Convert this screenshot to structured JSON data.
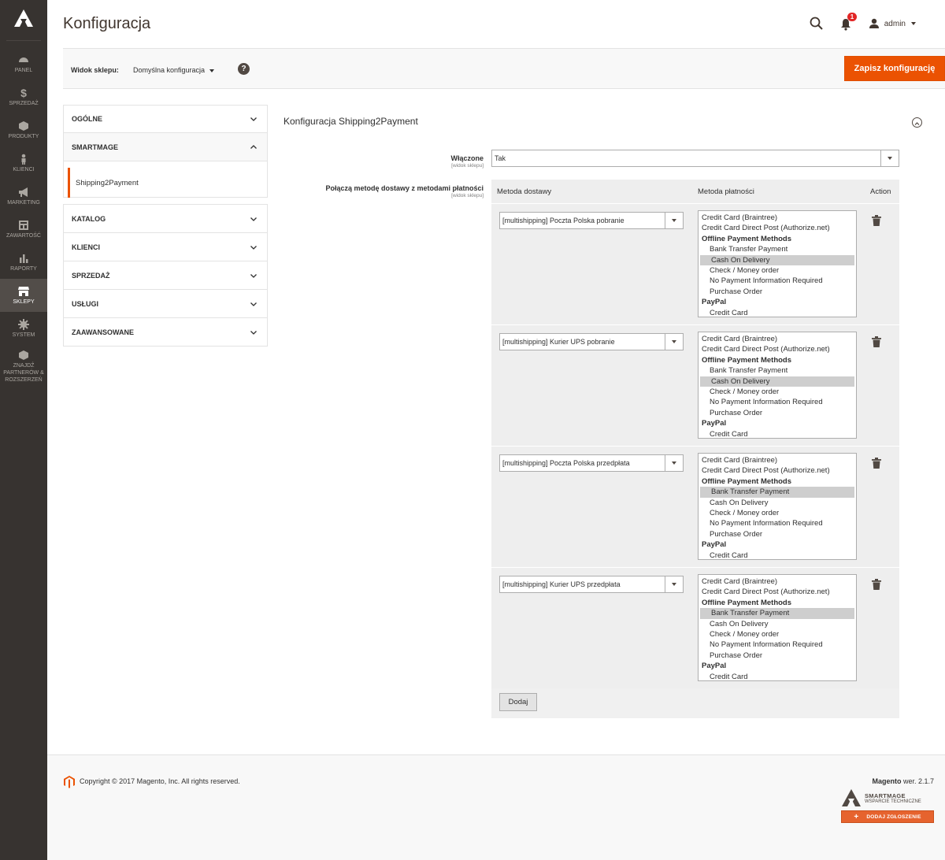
{
  "sidebar": {
    "items": [
      {
        "label": "PANEL",
        "icon": "dashboard-icon"
      },
      {
        "label": "SPRZEDAŻ",
        "icon": "dollar-icon"
      },
      {
        "label": "PRODUKTY",
        "icon": "box-icon"
      },
      {
        "label": "KLIENCI",
        "icon": "person-icon"
      },
      {
        "label": "MARKETING",
        "icon": "megaphone-icon"
      },
      {
        "label": "ZAWARTOŚĆ",
        "icon": "layout-icon"
      },
      {
        "label": "RAPORTY",
        "icon": "bar-chart-icon"
      },
      {
        "label": "SKLEPY",
        "icon": "store-icon",
        "active": true
      },
      {
        "label": "SYSTEM",
        "icon": "gear-icon"
      },
      {
        "label": "ZNAJDŹ PARTNERÓW & ROZSZERZEŃ",
        "icon": "extensions-icon"
      }
    ]
  },
  "header": {
    "title": "Konfiguracja",
    "notifications_count": "1",
    "user": "admin"
  },
  "store_bar": {
    "label": "Widok sklepu:",
    "scope": "Domyślna konfiguracja",
    "help": "?",
    "save_label": "Zapisz konfigurację"
  },
  "nav": {
    "sections": [
      {
        "label": "OGÓLNE"
      },
      {
        "label": "SMARTMAGE",
        "open": true,
        "sub": "Shipping2Payment"
      },
      {
        "label": "KATALOG"
      },
      {
        "label": "KLIENCI"
      },
      {
        "label": "SPRZEDAŻ"
      },
      {
        "label": "USŁUGI"
      },
      {
        "label": "ZAAWANSOWANE"
      }
    ]
  },
  "config": {
    "section_title": "Konfiguracja Shipping2Payment",
    "enabled_label": "Włączone",
    "enabled_scope": "[widok sklepu]",
    "enabled_value": "Tak",
    "mapping_label": "Połączą metodę dostawy z metodami płatności",
    "mapping_scope": "[widok sklepu]",
    "col_shipping": "Metoda dostawy",
    "col_payment": "Metoda płatności",
    "col_action": "Action",
    "add_label": "Dodaj",
    "payment_options": [
      {
        "label": "Credit Card (Braintree)",
        "type": "option"
      },
      {
        "label": "Credit Card Direct Post (Authorize.net)",
        "type": "option"
      },
      {
        "label": "Offline Payment Methods",
        "type": "group"
      },
      {
        "label": "Bank Transfer Payment",
        "type": "sub"
      },
      {
        "label": "Cash On Delivery",
        "type": "sub"
      },
      {
        "label": "Check / Money order",
        "type": "sub"
      },
      {
        "label": "No Payment Information Required",
        "type": "sub"
      },
      {
        "label": "Purchase Order",
        "type": "sub"
      },
      {
        "label": "PayPal",
        "type": "group"
      },
      {
        "label": "Credit Card",
        "type": "sub"
      }
    ],
    "rows": [
      {
        "shipping": "[multishipping] Poczta Polska pobranie",
        "selected_payment": "Cash On Delivery"
      },
      {
        "shipping": "[multishipping] Kurier UPS pobranie",
        "selected_payment": "Cash On Delivery"
      },
      {
        "shipping": "[multishipping] Poczta Polska przedpłata",
        "selected_payment": "Bank Transfer Payment"
      },
      {
        "shipping": "[multishipping] Kurier UPS przedpłata",
        "selected_payment": "Bank Transfer Payment"
      }
    ]
  },
  "footer": {
    "copyright": "Copyright © 2017 Magento, Inc. All rights reserved.",
    "brand": "Magento",
    "version": " wer. 2.1.7",
    "partner_name": "SMARTMAGE",
    "partner_sub": "WSPARCIE TECHNICZNE",
    "partner_button": "DODAJ ZGŁOSZENIE"
  },
  "colors": {
    "accent": "#eb5202",
    "sidebar_bg": "#373330"
  }
}
